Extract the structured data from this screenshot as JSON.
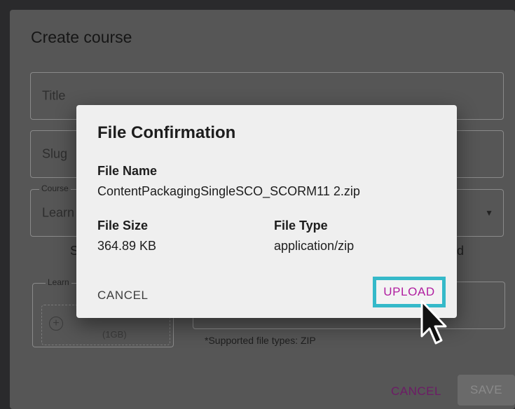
{
  "background_form": {
    "title": "Create course",
    "title_field": {
      "placeholder": "Title"
    },
    "slug_field": {
      "placeholder": "Slug"
    },
    "course_type": {
      "legend": "Course",
      "value": "Learn"
    },
    "description_left": "S",
    "description_right": "d",
    "upload_box": {
      "legend": "Learn",
      "size_note": "(1GB)"
    },
    "supported_types": "*Supported file types: ZIP",
    "cancel_label": "CANCEL",
    "save_label": "SAVE"
  },
  "dialog": {
    "title": "File Confirmation",
    "file_name_label": "File Name",
    "file_name_value": "ContentPackagingSingleSCO_SCORM11 2.zip",
    "file_size_label": "File Size",
    "file_size_value": "364.89 KB",
    "file_type_label": "File Type",
    "file_type_value": "application/zip",
    "cancel_label": "CANCEL",
    "upload_label": "UPLOAD"
  },
  "colors": {
    "upload_text": "#b01ea0",
    "upload_highlight": "#35b9c9",
    "cancel_bg_text": "#6d1b66"
  },
  "icons": {
    "add": "plus-circle-icon",
    "dropdown": "caret-down-icon",
    "pointer": "mouse-cursor-icon"
  }
}
